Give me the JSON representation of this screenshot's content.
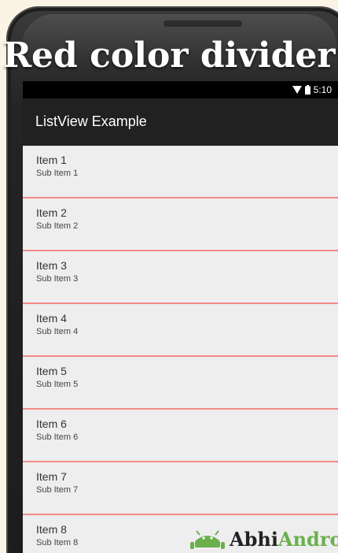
{
  "headline": "Red color divider",
  "status_bar": {
    "time": "5:10",
    "icons": [
      "wifi-icon",
      "battery-icon"
    ]
  },
  "app_bar": {
    "title": "ListView Example"
  },
  "list": {
    "items": [
      {
        "title": "Item 1",
        "subtitle": "Sub Item 1"
      },
      {
        "title": "Item 2",
        "subtitle": "Sub Item 2"
      },
      {
        "title": "Item 3",
        "subtitle": "Sub Item 3"
      },
      {
        "title": "Item 4",
        "subtitle": "Sub Item 4"
      },
      {
        "title": "Item 5",
        "subtitle": "Sub Item 5"
      },
      {
        "title": "Item 6",
        "subtitle": "Sub Item 6"
      },
      {
        "title": "Item 7",
        "subtitle": "Sub Item 7"
      },
      {
        "title": "Item 8",
        "subtitle": "Sub Item 8"
      }
    ],
    "divider_color": "#f48a8a"
  },
  "watermark": {
    "part1": "Abhi",
    "part2": "Androi",
    "accent_color": "#6ab04c"
  },
  "colors": {
    "app_bar": "#212121",
    "status_bar": "#000000",
    "list_background": "#eeeeee",
    "page_background": "#fbf4e6"
  }
}
